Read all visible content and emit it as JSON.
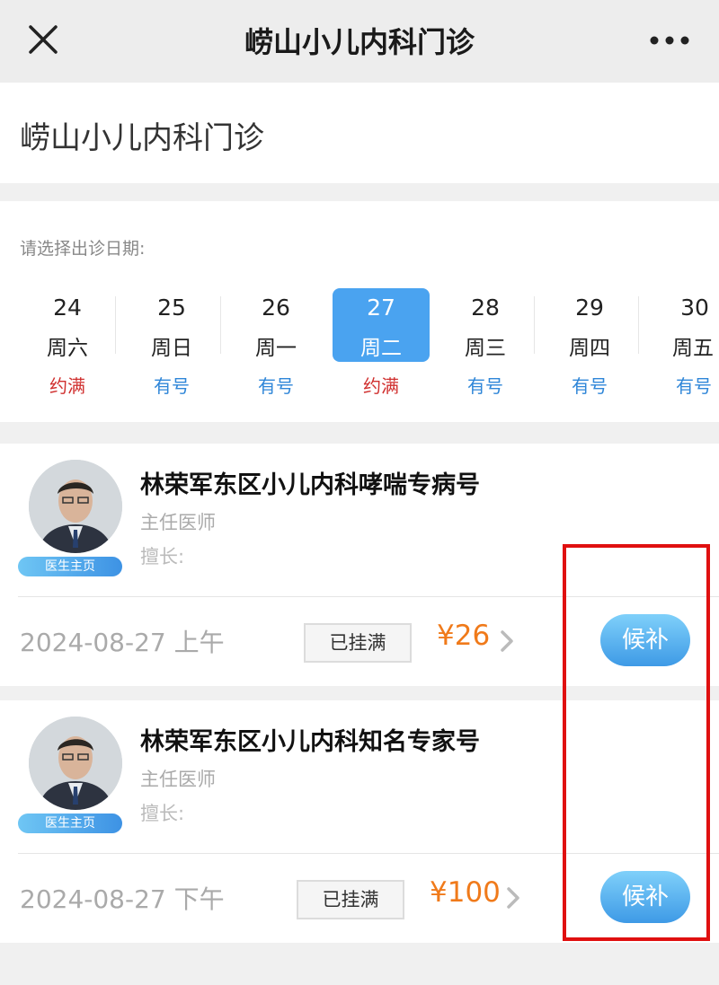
{
  "topbar": {
    "title": "崂山小儿内科门诊",
    "close_icon": "close-icon",
    "more_icon": "more-icon"
  },
  "header": {
    "dept_name": "崂山小儿内科门诊"
  },
  "date_picker": {
    "prompt": "请选择出诊日期:",
    "selected_index": 3,
    "dates": [
      {
        "day": "24",
        "weekday": "周六",
        "status": "约满",
        "status_type": "full"
      },
      {
        "day": "25",
        "weekday": "周日",
        "status": "有号",
        "status_type": "available"
      },
      {
        "day": "26",
        "weekday": "周一",
        "status": "有号",
        "status_type": "available"
      },
      {
        "day": "27",
        "weekday": "周二",
        "status": "约满",
        "status_type": "full"
      },
      {
        "day": "28",
        "weekday": "周三",
        "status": "有号",
        "status_type": "available"
      },
      {
        "day": "29",
        "weekday": "周四",
        "status": "有号",
        "status_type": "available"
      },
      {
        "day": "30",
        "weekday": "周五",
        "status": "有号",
        "status_type": "available"
      }
    ]
  },
  "doctors": [
    {
      "name": "林荣军东区小儿内科哮喘专病号",
      "title": "主任医师",
      "specialty": "擅长:",
      "homepage_tag": "医生主页",
      "slot": "2024-08-27 上午",
      "status": "已挂满",
      "price": "¥26",
      "action": "候补"
    },
    {
      "name": "林荣军东区小儿内科知名专家号",
      "title": "主任医师",
      "specialty": "擅长:",
      "homepage_tag": "医生主页",
      "slot": "2024-08-27 下午",
      "status": "已挂满",
      "price": "¥100",
      "action": "候补"
    }
  ],
  "colors": {
    "accent": "#4aa3f0",
    "full": "#d0302f",
    "available": "#2f86d8",
    "price": "#f07a1a",
    "highlight": "#e01010"
  }
}
